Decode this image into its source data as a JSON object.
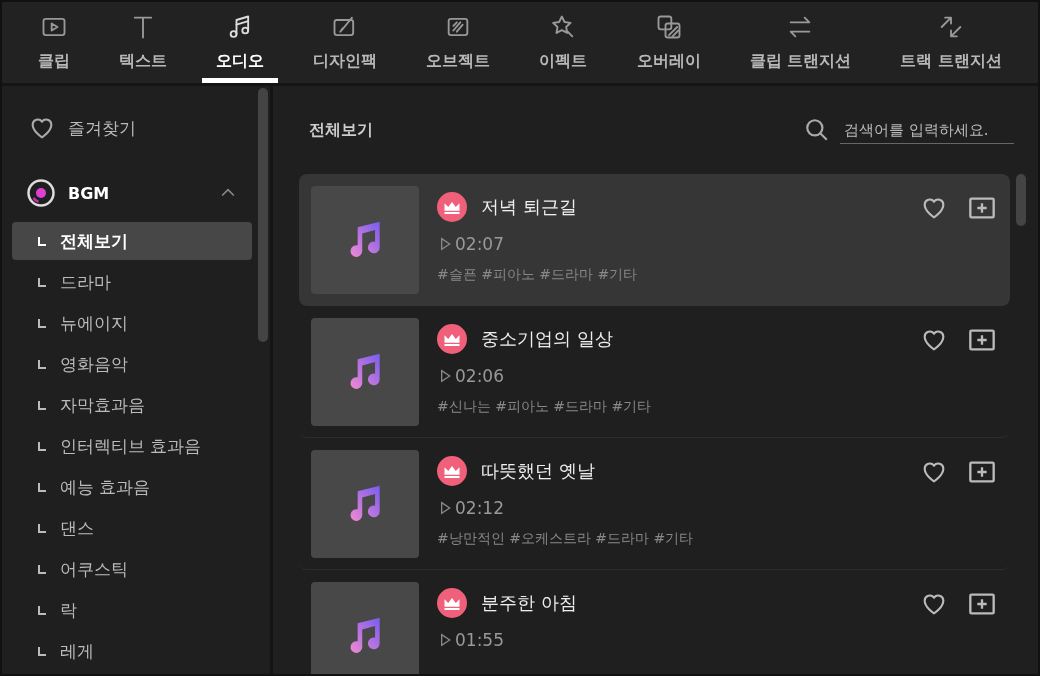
{
  "tabs": [
    {
      "label": "클립",
      "kind": "clip",
      "selected": false
    },
    {
      "label": "텍스트",
      "kind": "text",
      "selected": false
    },
    {
      "label": "오디오",
      "kind": "audio",
      "selected": true
    },
    {
      "label": "디자인팩",
      "kind": "design",
      "selected": false
    },
    {
      "label": "오브젝트",
      "kind": "object",
      "selected": false
    },
    {
      "label": "이펙트",
      "kind": "effect",
      "selected": false
    },
    {
      "label": "오버레이",
      "kind": "overlay",
      "selected": false
    },
    {
      "label": "클립 트랜지션",
      "kind": "swap",
      "selected": false
    },
    {
      "label": "트랙 트랜지션",
      "kind": "diag",
      "selected": false
    }
  ],
  "sidebar": {
    "favorites": "즐겨찾기",
    "category": {
      "label": "BGM",
      "expanded": true
    },
    "items": [
      {
        "label": "전체보기",
        "selected": true
      },
      {
        "label": "드라마",
        "selected": false
      },
      {
        "label": "뉴에이지",
        "selected": false
      },
      {
        "label": "영화음악",
        "selected": false
      },
      {
        "label": "자막효과음",
        "selected": false
      },
      {
        "label": "인터렉티브 효과음",
        "selected": false
      },
      {
        "label": "예능 효과음",
        "selected": false
      },
      {
        "label": "댄스",
        "selected": false
      },
      {
        "label": "어쿠스틱",
        "selected": false
      },
      {
        "label": "락",
        "selected": false
      },
      {
        "label": "레게",
        "selected": false
      }
    ]
  },
  "content": {
    "title": "전체보기",
    "search": {
      "placeholder": "검색어를 입력하세요."
    },
    "tracks": [
      {
        "title": "저녁 퇴근길",
        "duration": "02:07",
        "tags": "#슬픈 #피아노 #드라마 #기타",
        "premium": true,
        "favorite": false,
        "selected": true
      },
      {
        "title": "중소기업의 일상",
        "duration": "02:06",
        "tags": "#신나는 #피아노 #드라마 #기타",
        "premium": true,
        "favorite": false,
        "selected": false
      },
      {
        "title": "따뜻했던 옛날",
        "duration": "02:12",
        "tags": "#낭만적인 #오케스트라 #드라마 #기타",
        "premium": true,
        "favorite": false,
        "selected": false
      },
      {
        "title": "분주한 아침",
        "duration": "01:55",
        "premium": true,
        "favorite": false,
        "selected": false
      }
    ]
  }
}
